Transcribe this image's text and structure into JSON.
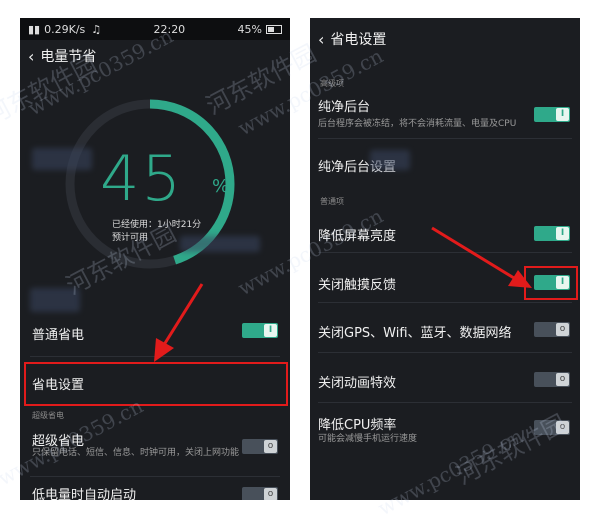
{
  "left": {
    "status": {
      "speed": "0.29K/s",
      "time": "22:20",
      "battery": "45%"
    },
    "title": "电量节省",
    "battery_percent": 45,
    "percent_digits": "45",
    "percent_sign": "%",
    "used_text": "已经使用：1小时21分",
    "remaining_text": "预计可用",
    "normal_saving": "普通省电",
    "saving_settings": "省电设置",
    "super_section": "超级省电",
    "super_saving": "超级省电",
    "super_desc": "只保留电话、短信、信息、时钟可用，关闭上网功能",
    "low_battery_auto": "低电量时自动启动"
  },
  "right": {
    "title": "省电设置",
    "advanced_section": "高级项",
    "pure_bg": "纯净后台",
    "pure_bg_desc": "后台程序会被冻结，将不会消耗流量、电量及CPU",
    "pure_bg_settings": "纯净后台设置",
    "normal_section": "普通项",
    "lower_brightness": "降低屏幕亮度",
    "close_haptic": "关闭触摸反馈",
    "close_connectivity": "关闭GPS、Wifi、蓝牙、数据网络",
    "close_animation": "关闭动画特效",
    "lower_cpu": "降低CPU频率",
    "lower_cpu_desc": "可能会减慢手机运行速度"
  },
  "watermark": {
    "site": "www.pc0359.cn",
    "name": "河东软件园"
  },
  "colors": {
    "accent": "#2fa98a",
    "highlight": "#e21b1b",
    "background": "#1b1d21"
  }
}
